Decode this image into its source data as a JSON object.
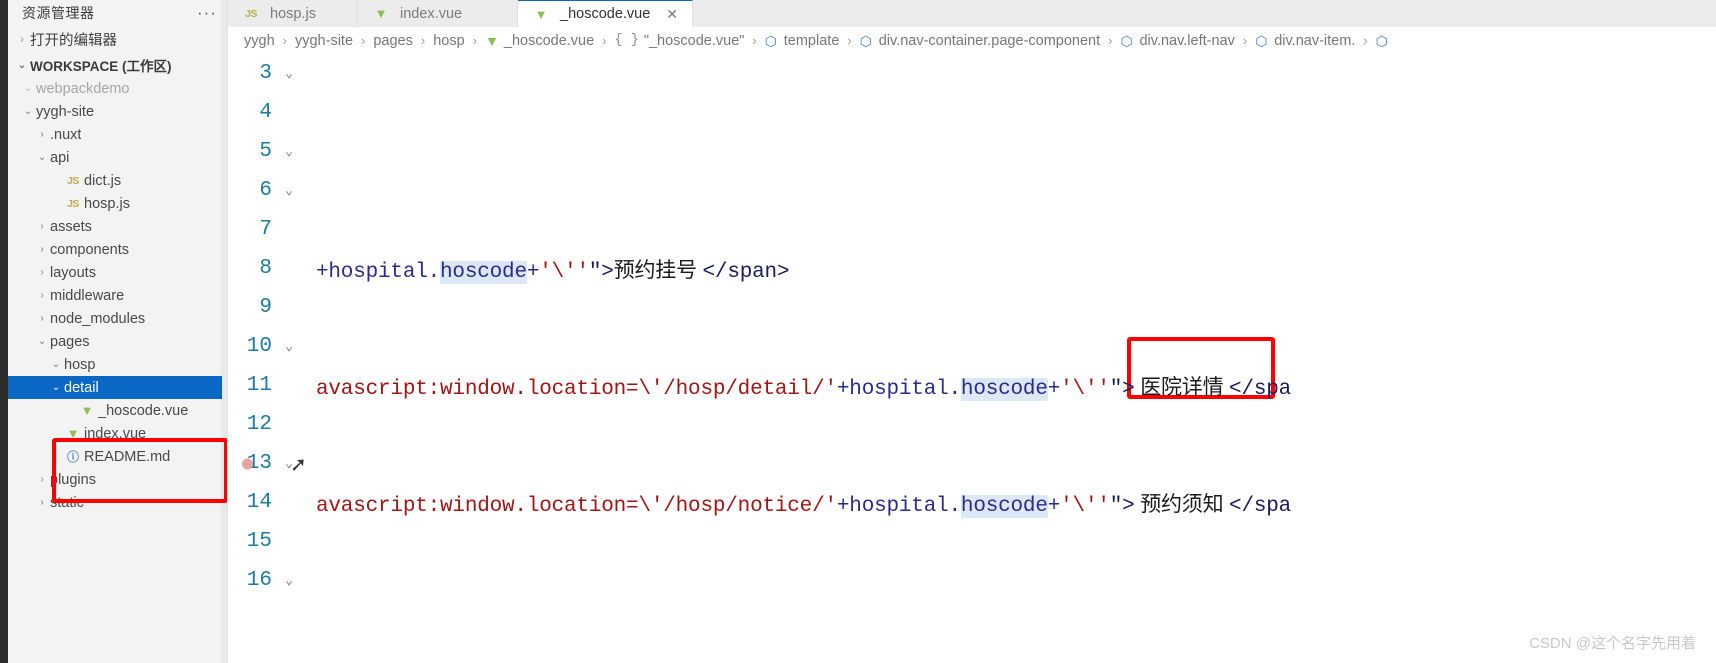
{
  "sidebar": {
    "header_title": "资源管理器",
    "more_icon": "···",
    "open_editors_label": "打开的编辑器",
    "workspace_label": "WORKSPACE (工作区)",
    "items": [
      {
        "label": "webpackdemo",
        "indent": 1,
        "chev": "⌄",
        "icon": "",
        "faded": true
      },
      {
        "label": "yygh-site",
        "indent": 1,
        "chev": "⌄",
        "icon": "",
        "faded": false
      },
      {
        "label": ".nuxt",
        "indent": 2,
        "chev": "›",
        "icon": "",
        "faded": false
      },
      {
        "label": "api",
        "indent": 2,
        "chev": "⌄",
        "icon": "",
        "faded": false
      },
      {
        "label": "dict.js",
        "indent": 3,
        "chev": "",
        "icon": "js",
        "faded": false
      },
      {
        "label": "hosp.js",
        "indent": 3,
        "chev": "",
        "icon": "js",
        "faded": false
      },
      {
        "label": "assets",
        "indent": 2,
        "chev": "›",
        "icon": "",
        "faded": false
      },
      {
        "label": "components",
        "indent": 2,
        "chev": "›",
        "icon": "",
        "faded": false
      },
      {
        "label": "layouts",
        "indent": 2,
        "chev": "›",
        "icon": "",
        "faded": false
      },
      {
        "label": "middleware",
        "indent": 2,
        "chev": "›",
        "icon": "",
        "faded": false
      },
      {
        "label": "node_modules",
        "indent": 2,
        "chev": "›",
        "icon": "",
        "faded": false
      },
      {
        "label": "pages",
        "indent": 2,
        "chev": "⌄",
        "icon": "",
        "faded": false
      },
      {
        "label": "hosp",
        "indent": 3,
        "chev": "⌄",
        "icon": "",
        "faded": false
      },
      {
        "label": "detail",
        "indent": 4,
        "chev": "⌄",
        "icon": "",
        "faded": false,
        "selected": true
      },
      {
        "label": "_hoscode.vue",
        "indent": 4,
        "chev": "",
        "icon": "vue",
        "faded": false
      },
      {
        "label": "index.vue",
        "indent": 3,
        "chev": "",
        "icon": "vue",
        "faded": false
      },
      {
        "label": "README.md",
        "indent": 3,
        "chev": "",
        "icon": "md",
        "faded": false
      },
      {
        "label": "plugins",
        "indent": 2,
        "chev": "›",
        "icon": "",
        "faded": false
      },
      {
        "label": "static",
        "indent": 2,
        "chev": "›",
        "icon": "",
        "faded": false
      }
    ]
  },
  "tabs": [
    {
      "label": "hosp.js",
      "icon": "js",
      "active": false,
      "close": ""
    },
    {
      "label": "index.vue",
      "icon": "vue",
      "active": false,
      "close": ""
    },
    {
      "label": "_hoscode.vue",
      "icon": "vue",
      "active": true,
      "close": "✕"
    }
  ],
  "breadcrumb": {
    "items": [
      {
        "label": "yygh",
        "icon": ""
      },
      {
        "label": "yygh-site",
        "icon": ""
      },
      {
        "label": "pages",
        "icon": ""
      },
      {
        "label": "hosp",
        "icon": ""
      },
      {
        "label": "_hoscode.vue",
        "icon": "vue"
      },
      {
        "label": "\"_hoscode.vue\"",
        "icon": "braces"
      },
      {
        "label": "template",
        "icon": "cube"
      },
      {
        "label": "div.nav-container.page-component",
        "icon": "cube"
      },
      {
        "label": "div.nav.left-nav",
        "icon": "cube"
      },
      {
        "label": "div.nav-item.",
        "icon": "cube"
      },
      {
        "label": "",
        "icon": "cube"
      }
    ],
    "separator": "›",
    "braces": "{ }"
  },
  "editor": {
    "lines": [
      {
        "num": "3",
        "fold": "⌄",
        "segments": [],
        "breakpoint": false
      },
      {
        "num": "4",
        "fold": "",
        "segments": [],
        "breakpoint": false
      },
      {
        "num": "5",
        "fold": "⌄",
        "segments": [],
        "breakpoint": false
      },
      {
        "num": "6",
        "fold": "⌄",
        "segments": [],
        "breakpoint": false
      },
      {
        "num": "7",
        "fold": "",
        "segments": [],
        "breakpoint": false
      },
      {
        "num": "8",
        "fold": "",
        "breakpoint": false,
        "segments": [
          {
            "t": "+hospital.",
            "c": "plain"
          },
          {
            "t": "hoscode",
            "c": "plain",
            "hl": true
          },
          {
            "t": "+",
            "c": "plain"
          },
          {
            "t": "'\\''",
            "c": "str"
          },
          {
            "t": "\"",
            "c": "punct"
          },
          {
            "t": ">",
            "c": "punct"
          },
          {
            "t": "预约挂号 ",
            "c": "cn"
          },
          {
            "t": "</span>",
            "c": "punct"
          }
        ]
      },
      {
        "num": "9",
        "fold": "",
        "segments": [],
        "breakpoint": false
      },
      {
        "num": "10",
        "fold": "⌄",
        "segments": [],
        "breakpoint": false
      },
      {
        "num": "11",
        "fold": "",
        "breakpoint": false,
        "segments": [
          {
            "t": "avascript:window.location=\\'/hosp/detail/'",
            "c": "str"
          },
          {
            "t": "+hospital.",
            "c": "plain"
          },
          {
            "t": "hoscode",
            "c": "plain",
            "hl": true
          },
          {
            "t": "+",
            "c": "plain"
          },
          {
            "t": "'\\''",
            "c": "str"
          },
          {
            "t": "\"",
            "c": "punct"
          },
          {
            "t": ">",
            "c": "punct"
          },
          {
            "t": " 医院详情 ",
            "c": "cn"
          },
          {
            "t": "</spa",
            "c": "punct"
          }
        ]
      },
      {
        "num": "12",
        "fold": "",
        "segments": [],
        "breakpoint": false
      },
      {
        "num": "13",
        "fold": "⌄",
        "segments": [],
        "breakpoint": true
      },
      {
        "num": "14",
        "fold": "",
        "breakpoint": false,
        "segments": [
          {
            "t": "avascript:window.location=\\'/hosp/notice/'",
            "c": "str"
          },
          {
            "t": "+hospital.",
            "c": "plain"
          },
          {
            "t": "hoscode",
            "c": "plain",
            "hl": true
          },
          {
            "t": "+",
            "c": "plain"
          },
          {
            "t": "'\\''",
            "c": "str"
          },
          {
            "t": "\"",
            "c": "punct"
          },
          {
            "t": ">",
            "c": "punct"
          },
          {
            "t": " 预约须知 ",
            "c": "cn"
          },
          {
            "t": "</spa",
            "c": "punct"
          }
        ]
      },
      {
        "num": "15",
        "fold": "",
        "segments": [],
        "breakpoint": false
      },
      {
        "num": "16",
        "fold": "⌄",
        "segments": [],
        "breakpoint": false
      }
    ],
    "mouse_cursor": "↱"
  },
  "annotations": {
    "sidebar_box_color": "#ff0000",
    "code_box_color": "#ff0000"
  },
  "watermark": "CSDN @这个名字先用着"
}
